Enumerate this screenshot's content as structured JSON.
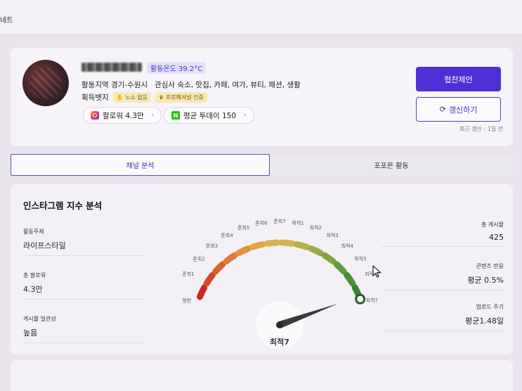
{
  "topbar": {
    "crumb": "네트"
  },
  "profile": {
    "temperature": "활동온도 39.2°C",
    "region_label": "활동지역",
    "region_value": "경기-수원시",
    "interest_label": "관심사",
    "interest_value": "숙소, 맛집, 카페, 여가, 뷰티, 패션, 생활",
    "badge_label": "획득뱃지",
    "badges": [
      "노쇼 없음",
      "프로페셔널 인증"
    ],
    "followers": "팔로워 4.3만",
    "today": "평균 투데이 150",
    "sponsor_button": "협찬제안",
    "refresh_button": "갱신하기",
    "updated": "최근 갱신 : 1일 전"
  },
  "tabs": {
    "channel": "채널 분석",
    "activity": "포포몬 활동"
  },
  "analysis": {
    "title": "인스타그램 지수 분석",
    "left": [
      {
        "label": "활동주제",
        "value": "라이프스타일"
      },
      {
        "label": "총 팔로워",
        "value": "4.3만"
      },
      {
        "label": "게시물 일관성",
        "value": "높음"
      }
    ],
    "right": [
      {
        "label": "총 게시물",
        "value": "425"
      },
      {
        "label": "콘텐츠 반응",
        "value": "평균 0.5%"
      },
      {
        "label": "업로드 주기",
        "value": "평균1.48일"
      }
    ],
    "gauge": {
      "levels": [
        "일반",
        "준최1",
        "준최2",
        "준최3",
        "준최4",
        "준최5",
        "준최6",
        "준최7",
        "최적1",
        "최적2",
        "최적3",
        "최적4",
        "최적5",
        "최적6",
        "최적7"
      ],
      "current_index": 14,
      "current_label": "최적7"
    }
  },
  "icons": {
    "instagram": "instagram-icon",
    "naver": "naver-icon",
    "refresh": "refresh-icon",
    "cursor": "mouse-cursor-icon"
  }
}
